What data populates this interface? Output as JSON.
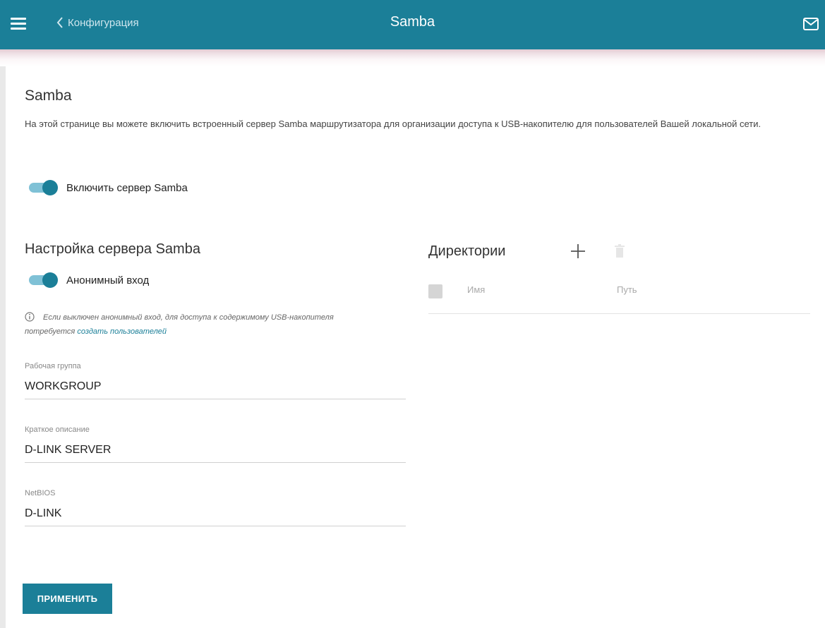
{
  "header": {
    "back_label": "Конфигурация",
    "title": "Samba"
  },
  "page": {
    "title": "Samba",
    "description": "На этой странице вы можете включить встроенный сервер Samba маршрутизатора для организации доступа к USB-накопителю для пользователей Вашей локальной сети.",
    "enable_label": "Включить сервер Samba",
    "enable_on": true
  },
  "server_settings": {
    "title": "Настройка сервера Samba",
    "anonymous_label": "Анонимный вход",
    "anonymous_on": true,
    "info_text": "Если выключен анонимный вход, для доступа к содержимому USB-накопителя потребуется ",
    "info_link": "создать пользователей",
    "fields": {
      "workgroup_label": "Рабочая группа",
      "workgroup_value": "WORKGROUP",
      "description_label": "Краткое описание",
      "description_value": "D-LINK SERVER",
      "netbios_label": "NetBIOS",
      "netbios_value": "D-LINK"
    }
  },
  "directories": {
    "title": "Директории",
    "columns": [
      "Имя",
      "Путь"
    ],
    "rows": []
  },
  "actions": {
    "apply_label": "ПРИМЕНИТЬ"
  },
  "icons": {
    "menu": "hamburger-icon",
    "back": "chevron-left-icon",
    "notifications": "mail-icon",
    "info": "info-icon",
    "add": "plus-icon",
    "delete": "trash-icon"
  },
  "colors": {
    "accent": "#1b7f98",
    "toggle_track": "#7fc1d6",
    "link": "#1b7f98"
  }
}
